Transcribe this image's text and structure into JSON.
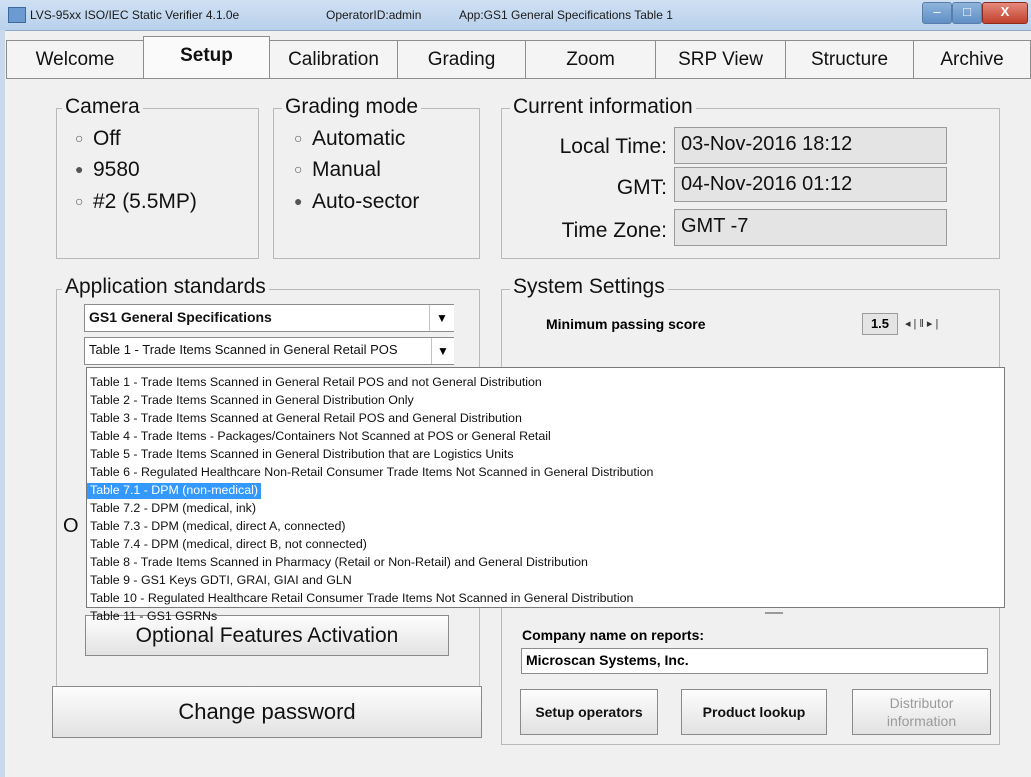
{
  "window": {
    "title": "LVS-95xx ISO/IEC Static Verifier 4.1.0e",
    "operator": "OperatorID:admin",
    "app": "App:GS1 General Specifications Table 1",
    "minimize": "–",
    "maximize": "□",
    "close": "X"
  },
  "tabs": [
    {
      "label": "Welcome"
    },
    {
      "label": "Setup"
    },
    {
      "label": "Calibration"
    },
    {
      "label": "Grading"
    },
    {
      "label": "Zoom"
    },
    {
      "label": "SRP View"
    },
    {
      "label": "Structure"
    },
    {
      "label": "Archive"
    }
  ],
  "active_tab": "Setup",
  "camera": {
    "legend": "Camera",
    "options": [
      {
        "label": "Off",
        "selected": false
      },
      {
        "label": "9580",
        "selected": true
      },
      {
        "label": "#2 (5.5MP)",
        "selected": false
      }
    ]
  },
  "grading_mode": {
    "legend": "Grading mode",
    "options": [
      {
        "label": "Automatic",
        "selected": false
      },
      {
        "label": "Manual",
        "selected": false
      },
      {
        "label": "Auto-sector",
        "selected": true
      }
    ]
  },
  "current_info": {
    "legend": "Current information",
    "local_time_label": "Local Time:",
    "local_time": "03-Nov-2016 18:12",
    "gmt_label": "GMT:",
    "gmt": "04-Nov-2016 01:12",
    "timezone_label": "Time Zone:",
    "timezone": "GMT -7"
  },
  "app_standards": {
    "legend": "Application standards",
    "standard": "GS1 General Specifications",
    "table": "Table 1 - Trade Items Scanned in General Retail POS",
    "hidden_label_fragment": "O",
    "options": [
      "Table 1 - Trade Items Scanned in General Retail POS and not General Distribution",
      "Table 2 - Trade Items Scanned in General Distribution Only",
      "Table 3 - Trade Items Scanned at General Retail POS and General Distribution",
      "Table 4 - Trade Items - Packages/Containers Not Scanned at POS or General Retail",
      "Table 5 - Trade Items Scanned in General Distribution that are Logistics Units",
      "Table 6 - Regulated Healthcare Non-Retail Consumer Trade Items Not Scanned in General Distribution",
      "Table 7.1 - DPM (non-medical)",
      "Table 7.2 - DPM (medical, ink)",
      "Table 7.3 - DPM (medical, direct A, connected)",
      "Table 7.4 - DPM (medical, direct B, not connected)",
      "Table 8 - Trade Items Scanned in Pharmacy (Retail or Non-Retail) and General Distribution",
      "Table 9 - GS1 Keys GDTI, GRAI, GIAI and GLN",
      "Table 10 - Regulated Healthcare Retail Consumer Trade Items Not Scanned in General Distribution",
      "Table 11 - GS1 GSRNs"
    ],
    "highlighted_index": 6,
    "optional_features_button": "Optional Features Activation"
  },
  "system_settings": {
    "legend": "System Settings",
    "min_passing_label": "Minimum passing score",
    "min_passing_value": "1.5",
    "company_label": "Company name on reports:",
    "company_value": "Microscan Systems, Inc.",
    "setup_operators_button": "Setup operators",
    "product_lookup_button": "Product lookup",
    "distributor_button_line1": "Distributor",
    "distributor_button_line2": "information"
  },
  "change_password_button": "Change password"
}
